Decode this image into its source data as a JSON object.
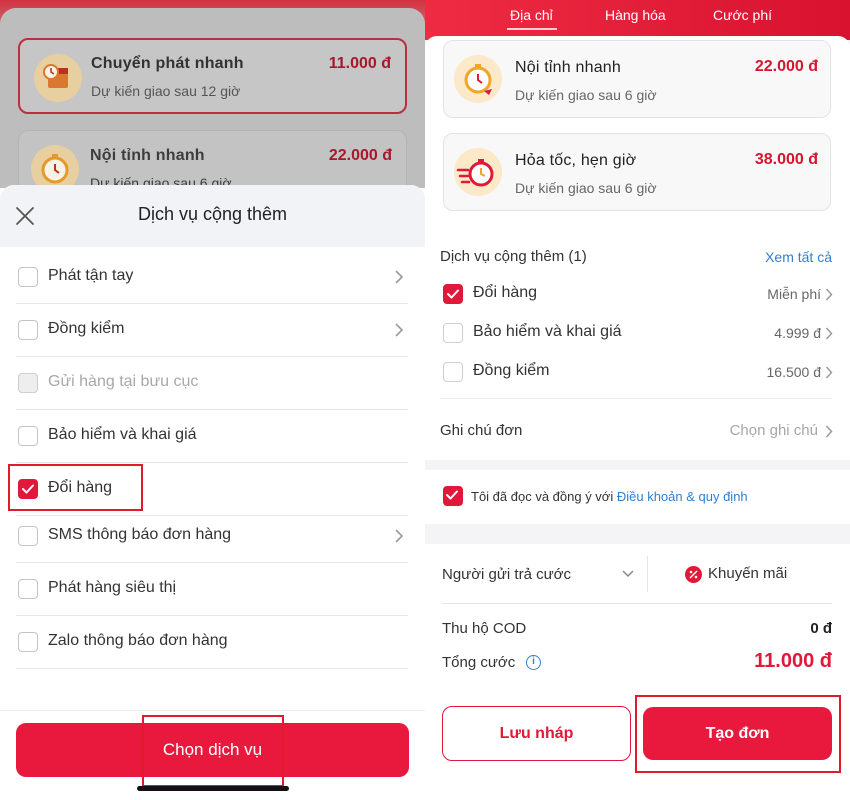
{
  "left": {
    "shipping_options": [
      {
        "name": "Chuyển phát nhanh",
        "eta": "Dự kiến giao sau 12 giờ",
        "price": "11.000 đ"
      },
      {
        "name": "Nội tỉnh nhanh",
        "eta": "Dự kiến giao sau 6 giờ",
        "price": "22.000 đ"
      }
    ],
    "sheet": {
      "title": "Dịch vụ cộng thêm",
      "options": [
        {
          "label": "Phát tận tay",
          "checked": false,
          "disabled": false,
          "has_chevron": true
        },
        {
          "label": "Đồng kiểm",
          "checked": false,
          "disabled": false,
          "has_chevron": true
        },
        {
          "label": "Gửi hàng tại bưu cục",
          "checked": false,
          "disabled": true,
          "has_chevron": false
        },
        {
          "label": "Bảo hiểm và khai giá",
          "checked": false,
          "disabled": false,
          "has_chevron": false
        },
        {
          "label": "Đổi hàng",
          "checked": true,
          "disabled": false,
          "has_chevron": false
        },
        {
          "label": "SMS thông báo đơn hàng",
          "checked": false,
          "disabled": false,
          "has_chevron": true
        },
        {
          "label": "Phát hàng siêu thị",
          "checked": false,
          "disabled": false,
          "has_chevron": false
        },
        {
          "label": "Zalo thông báo đơn hàng",
          "checked": false,
          "disabled": false,
          "has_chevron": false
        }
      ],
      "confirm_label": "Chọn dịch vụ"
    }
  },
  "right": {
    "tabs": [
      "Địa chỉ",
      "Hàng hóa",
      "Cước phí"
    ],
    "shipping_options": [
      {
        "name": "Nội tỉnh nhanh",
        "eta": "Dự kiến giao sau 6 giờ",
        "price": "22.000 đ"
      },
      {
        "name": "Hỏa tốc, hẹn giờ",
        "eta": "Dự kiến giao sau 6 giờ",
        "price": "38.000 đ"
      }
    ],
    "addon": {
      "title": "Dịch vụ cộng thêm (1)",
      "see_all": "Xem tất cả",
      "items": [
        {
          "label": "Đổi hàng",
          "value": "Miễn phí",
          "checked": true
        },
        {
          "label": "Bảo hiểm và khai giá",
          "value": "4.999 đ",
          "checked": false
        },
        {
          "label": "Đồng kiểm",
          "value": "16.500 đ",
          "checked": false
        }
      ]
    },
    "note": {
      "label": "Ghi chú đơn",
      "placeholder": "Chọn ghi chú"
    },
    "terms": {
      "text": "Tôi đã đọc và đồng ý với",
      "link": "Điều khoản & quy định",
      "checked": true
    },
    "payer": "Người gửi trả cước",
    "promo": "Khuyến mãi",
    "cod": {
      "label": "Thu hộ COD",
      "value": "0 đ"
    },
    "total": {
      "label": "Tổng cước",
      "value": "11.000 đ"
    },
    "draft_label": "Lưu nháp",
    "create_label": "Tạo đơn"
  },
  "colors": {
    "brand_red": "#e8193c",
    "link_blue": "#2f7fd1",
    "highlight": "#e01b2f"
  }
}
